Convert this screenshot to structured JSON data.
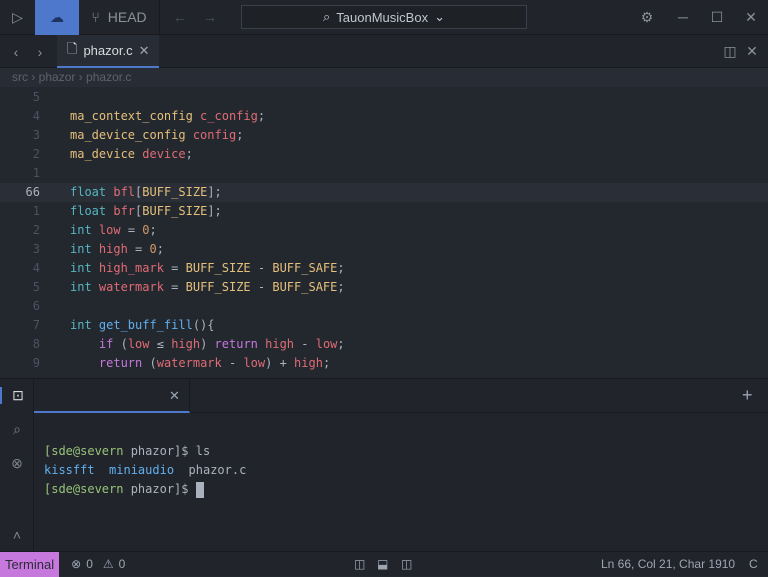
{
  "titlebar": {
    "branch": "HEAD",
    "search": "TauonMusicBox"
  },
  "tab": {
    "label": "phazor.c"
  },
  "breadcrumb": [
    "src",
    "phazor",
    "phazor.c"
  ],
  "editor": {
    "lines": [
      {
        "n": "5",
        "t": []
      },
      {
        "n": "4",
        "t": [
          [
            "ma_context_config ",
            "mac"
          ],
          [
            "c_config",
            "var"
          ],
          [
            ";",
            "pl"
          ]
        ]
      },
      {
        "n": "3",
        "t": [
          [
            "ma_device_config ",
            "mac"
          ],
          [
            "config",
            "var"
          ],
          [
            ";",
            "pl"
          ]
        ]
      },
      {
        "n": "2",
        "t": [
          [
            "ma_device ",
            "mac"
          ],
          [
            "device",
            "var"
          ],
          [
            ";",
            "pl"
          ]
        ]
      },
      {
        "n": "1",
        "t": []
      },
      {
        "n": "66",
        "cur": true,
        "t": [
          [
            "float ",
            "kw"
          ],
          [
            "bfl",
            "var"
          ],
          [
            "[",
            "pl"
          ],
          [
            "BUFF_SIZE",
            "mac"
          ],
          [
            "];",
            "pl"
          ]
        ]
      },
      {
        "n": "1",
        "t": [
          [
            "float ",
            "kw"
          ],
          [
            "bfr",
            "var"
          ],
          [
            "[",
            "pl"
          ],
          [
            "BUFF_SIZE",
            "mac"
          ],
          [
            "];",
            "pl"
          ]
        ]
      },
      {
        "n": "2",
        "t": [
          [
            "int ",
            "kw"
          ],
          [
            "low",
            "var"
          ],
          [
            " = ",
            "pl"
          ],
          [
            "0",
            "num"
          ],
          [
            ";",
            "pl"
          ]
        ]
      },
      {
        "n": "3",
        "t": [
          [
            "int ",
            "kw"
          ],
          [
            "high",
            "var"
          ],
          [
            " = ",
            "pl"
          ],
          [
            "0",
            "num"
          ],
          [
            ";",
            "pl"
          ]
        ]
      },
      {
        "n": "4",
        "t": [
          [
            "int ",
            "kw"
          ],
          [
            "high_mark",
            "var"
          ],
          [
            " = ",
            "pl"
          ],
          [
            "BUFF_SIZE",
            "mac"
          ],
          [
            " - ",
            "pl"
          ],
          [
            "BUFF_SAFE",
            "mac"
          ],
          [
            ";",
            "pl"
          ]
        ]
      },
      {
        "n": "5",
        "t": [
          [
            "int ",
            "kw"
          ],
          [
            "watermark",
            "var"
          ],
          [
            " = ",
            "pl"
          ],
          [
            "BUFF_SIZE",
            "mac"
          ],
          [
            " - ",
            "pl"
          ],
          [
            "BUFF_SAFE",
            "mac"
          ],
          [
            ";",
            "pl"
          ]
        ]
      },
      {
        "n": "6",
        "t": []
      },
      {
        "n": "7",
        "t": [
          [
            "int ",
            "kw"
          ],
          [
            "get_buff_fill",
            "fn"
          ],
          [
            "(){",
            "pl"
          ]
        ]
      },
      {
        "n": "8",
        "t": [
          [
            "    if ",
            "ctl"
          ],
          [
            "(",
            "pl"
          ],
          [
            "low",
            "var"
          ],
          [
            " ≤ ",
            "pl"
          ],
          [
            "high",
            "var"
          ],
          [
            ") ",
            "pl"
          ],
          [
            "return ",
            "ctl"
          ],
          [
            "high",
            "var"
          ],
          [
            " - ",
            "pl"
          ],
          [
            "low",
            "var"
          ],
          [
            ";",
            "pl"
          ]
        ]
      },
      {
        "n": "9",
        "t": [
          [
            "    return ",
            "ctl"
          ],
          [
            "(",
            "pl"
          ],
          [
            "watermark",
            "var"
          ],
          [
            " - ",
            "pl"
          ],
          [
            "low",
            "var"
          ],
          [
            ") + ",
            "pl"
          ],
          [
            "high",
            "var"
          ],
          [
            ";",
            "pl"
          ]
        ]
      }
    ]
  },
  "terminal": {
    "prompt_user": "[sde@severn",
    "prompt_dir": " phazor]$",
    "cmd": " ls",
    "files": [
      "kissfft",
      "miniaudio",
      "phazor.c"
    ]
  },
  "status": {
    "mode": "Terminal",
    "errors": "0",
    "warnings": "0",
    "position": "Ln 66, Col 21, Char 1910",
    "lang": "C"
  },
  "colors": {
    "accent": "#4d78cc",
    "mode_badge": "#c678dd"
  }
}
